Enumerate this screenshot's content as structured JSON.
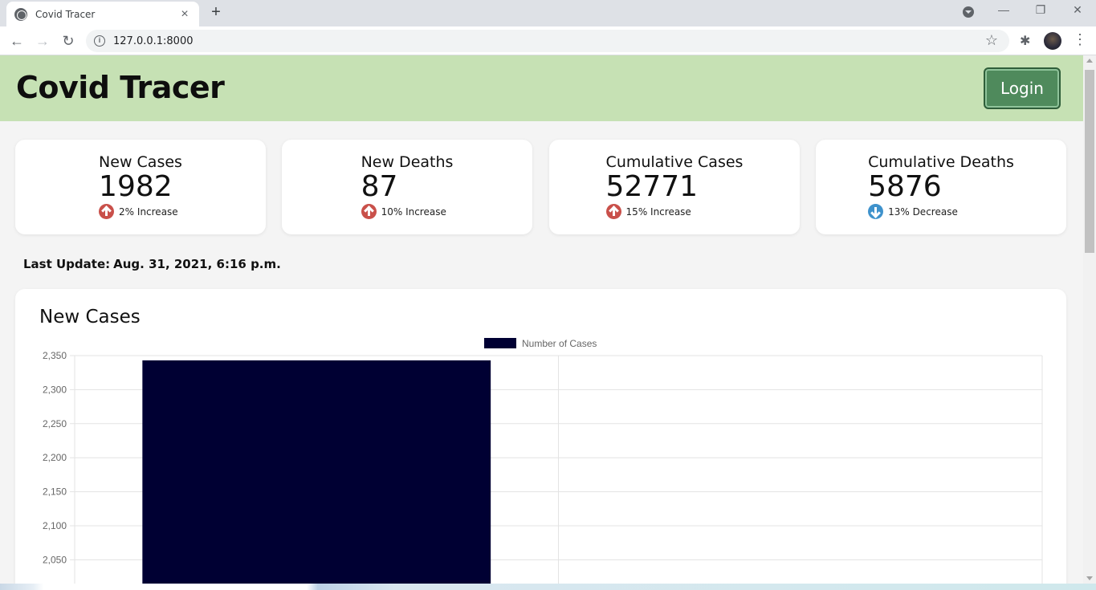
{
  "browser": {
    "tab_title": "Covid Tracer",
    "tab_close": "×",
    "new_tab": "+",
    "url": "127.0.0.1:8000",
    "back": "←",
    "forward": "→",
    "reload": "↻",
    "star": "☆",
    "extensions": "✱",
    "menu": "⋮",
    "minimize": "—",
    "restore": "❐",
    "close": "✕",
    "info": "i"
  },
  "header": {
    "brand": "Covid Tracer",
    "login_label": "Login",
    "bg_color": "#c6e1b4",
    "button_color": "#4f8a5c"
  },
  "stats": [
    {
      "title": "New Cases",
      "value": "1982",
      "trend": "up",
      "trend_text": "2% Increase"
    },
    {
      "title": "New Deaths",
      "value": "87",
      "trend": "up",
      "trend_text": "10% Increase"
    },
    {
      "title": "Cumulative Cases",
      "value": "52771",
      "trend": "up",
      "trend_text": "15% Increase"
    },
    {
      "title": "Cumulative Deaths",
      "value": "5876",
      "trend": "down",
      "trend_text": "13% Decrease"
    }
  ],
  "last_update": {
    "label": "Last Update:",
    "value": "Aug. 31, 2021, 6:16 p.m."
  },
  "chart_section": {
    "title": "New Cases"
  },
  "chart_data": {
    "type": "bar",
    "legend": [
      {
        "name": "Number of Cases",
        "color": "#000033"
      }
    ],
    "legend_position": "top-center",
    "y_ticks": [
      2350,
      2300,
      2250,
      2200,
      2150,
      2100,
      2050
    ],
    "y_tick_labels": [
      "2,350",
      "2,300",
      "2,250",
      "2,200",
      "2,150",
      "2,100",
      "2,050"
    ],
    "ylim_visible": [
      2030,
      2350
    ],
    "grid": true,
    "series": [
      {
        "name": "Number of Cases",
        "values": [
          2343,
          null
        ]
      }
    ],
    "bar_color": "#000033"
  }
}
